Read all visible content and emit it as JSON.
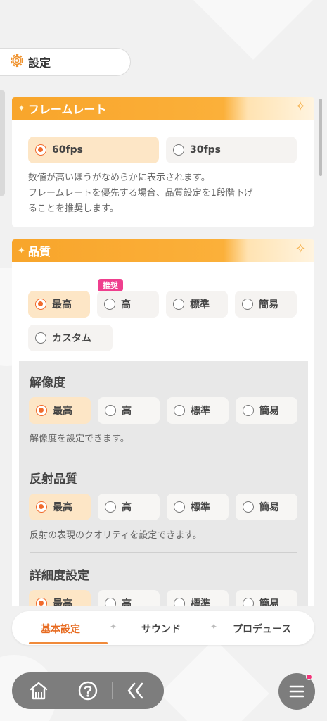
{
  "header": {
    "title": "設定",
    "icon": "gear-icon"
  },
  "framerate": {
    "title": "フレームレート",
    "options": [
      "60fps",
      "30fps"
    ],
    "selected": "60fps",
    "desc_line1": "数値が高いほうがなめらかに表示されます。",
    "desc_line2": "フレームレートを優先する場合、品質設定を1段階下げ",
    "desc_line3": "ることを推奨します。"
  },
  "quality": {
    "title": "品質",
    "badge": "推奨",
    "options": [
      "最高",
      "高",
      "標準",
      "簡易",
      "カスタム"
    ],
    "selected": "最高"
  },
  "resolution": {
    "title": "解像度",
    "options": [
      "最高",
      "高",
      "標準",
      "簡易"
    ],
    "selected": "最高",
    "desc": "解像度を設定できます。"
  },
  "reflection": {
    "title": "反射品質",
    "options": [
      "最高",
      "高",
      "標準",
      "簡易"
    ],
    "selected": "最高",
    "desc": "反射の表現のクオリティを設定できます。"
  },
  "detail": {
    "title": "詳細度設定",
    "options": [
      "最高",
      "高",
      "標準",
      "簡易"
    ],
    "selected": "最高"
  },
  "tabs": {
    "basic": "基本設定",
    "sound": "サウンド",
    "produce": "プロデュース",
    "separator": "✦",
    "active": "基本設定"
  },
  "nav": {
    "home_icon": "home-icon",
    "help_icon": "help-icon",
    "back_icon": "back-icon",
    "menu_icon": "menu-icon"
  },
  "colors": {
    "accent": "#f06a2c",
    "header_gradient": "#f8a52b",
    "badge": "#ef3f8e",
    "selected_bg": "#fde6c6"
  }
}
